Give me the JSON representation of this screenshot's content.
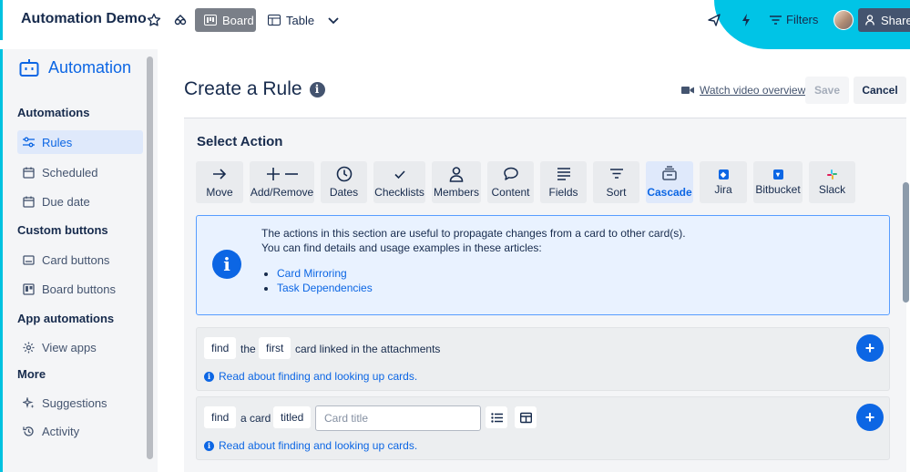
{
  "topbar": {
    "board_title": "Automation Demo",
    "board_view_label": "Board",
    "table_view_label": "Table",
    "filters_label": "Filters",
    "share_label": "Share"
  },
  "sidebar": {
    "header": "Automation",
    "sections": [
      {
        "title": "Automations",
        "items": [
          {
            "label": "Rules",
            "icon": "sliders-icon",
            "active": true
          },
          {
            "label": "Scheduled",
            "icon": "calendar-icon"
          },
          {
            "label": "Due date",
            "icon": "calendar-icon"
          }
        ]
      },
      {
        "title": "Custom buttons",
        "items": [
          {
            "label": "Card buttons",
            "icon": "card-icon"
          },
          {
            "label": "Board buttons",
            "icon": "board-icon"
          }
        ]
      },
      {
        "title": "App automations",
        "items": [
          {
            "label": "View apps",
            "icon": "gear-icon"
          }
        ]
      },
      {
        "title": "More",
        "items": [
          {
            "label": "Suggestions",
            "icon": "sparkle-icon"
          },
          {
            "label": "Activity",
            "icon": "history-icon"
          }
        ]
      }
    ]
  },
  "main": {
    "page_title": "Create a Rule",
    "watch_video_label": "Watch video overview",
    "save_label": "Save",
    "cancel_label": "Cancel",
    "select_action_title": "Select Action",
    "actions": [
      {
        "label": "Move",
        "icon": "arrow-right-icon"
      },
      {
        "label": "Add/Remove",
        "icon": "plus-minus-icon"
      },
      {
        "label": "Dates",
        "icon": "clock-icon"
      },
      {
        "label": "Checklists",
        "icon": "check-icon"
      },
      {
        "label": "Members",
        "icon": "person-icon"
      },
      {
        "label": "Content",
        "icon": "comment-icon"
      },
      {
        "label": "Fields",
        "icon": "fields-icon"
      },
      {
        "label": "Sort",
        "icon": "sort-icon"
      },
      {
        "label": "Cascade",
        "icon": "cascade-icon",
        "selected": true
      },
      {
        "label": "Jira",
        "icon": "jira-icon"
      },
      {
        "label": "Bitbucket",
        "icon": "bitbucket-icon"
      },
      {
        "label": "Slack",
        "icon": "slack-icon"
      }
    ],
    "info": {
      "line1": "The actions in this section are useful to propagate changes from a card to other card(s).",
      "line2": "You can find details and usage examples in these articles:",
      "links": [
        "Card Mirroring",
        "Task Dependencies"
      ]
    },
    "rule1": {
      "find": "find",
      "the": "the",
      "first": "first",
      "rest": "card linked in the attachments",
      "help": "Read about finding and looking up cards."
    },
    "rule2": {
      "find": "find",
      "a_card": "a card",
      "titled": "titled",
      "placeholder": "Card title",
      "help": "Read about finding and looking up cards."
    }
  },
  "colors": {
    "accent": "#0c66e4",
    "cyan": "#00c4e6",
    "board_btn": "#7a7f88",
    "share_btn": "#44546f"
  }
}
